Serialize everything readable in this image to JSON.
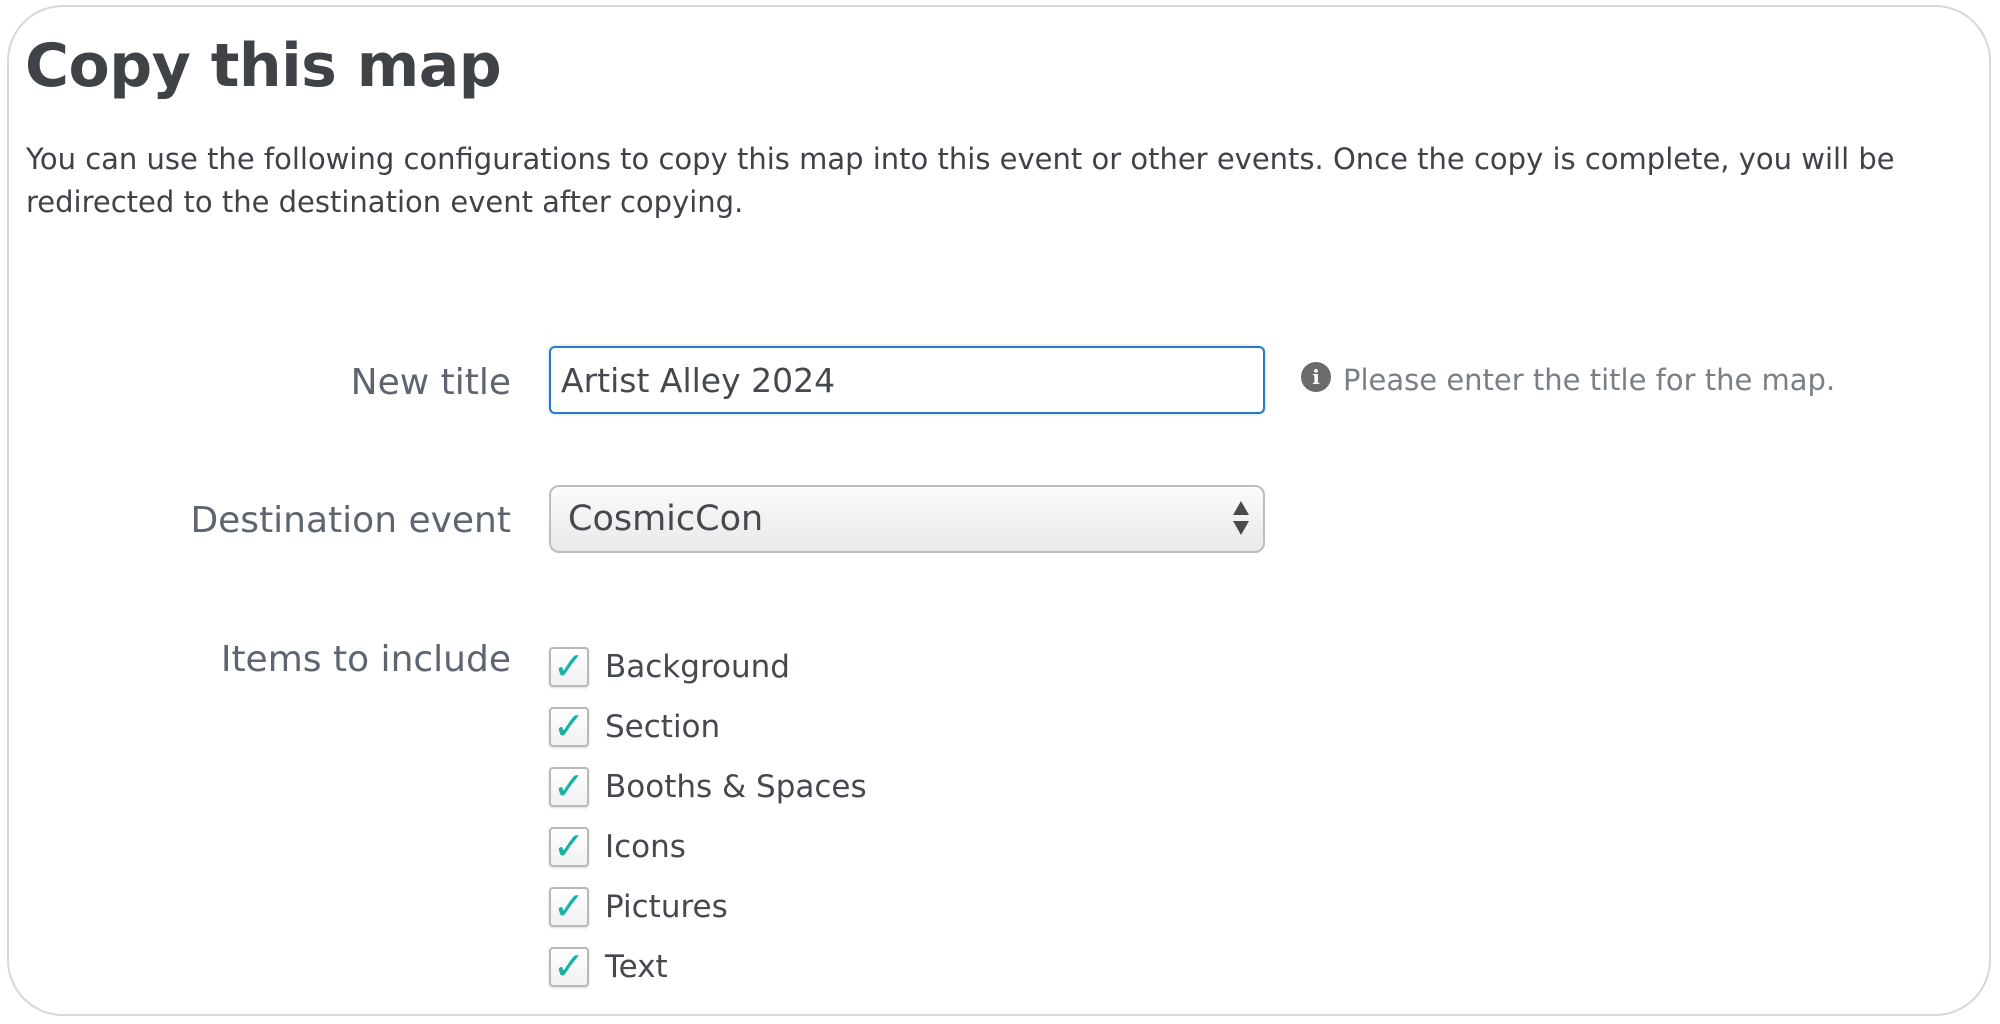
{
  "page": {
    "title": "Copy this map",
    "description": "You can use the following configurations to copy this map into this event or other events. Once the copy is complete, you will be redirected to the destination event after copying."
  },
  "form": {
    "new_title": {
      "label": "New title",
      "value": "Artist Alley 2024",
      "hint": "Please enter the title for the map.",
      "hint_icon": "info-icon"
    },
    "destination_event": {
      "label": "Destination event",
      "selected": "CosmicCon"
    },
    "items_to_include": {
      "label": "Items to include",
      "options": [
        {
          "label": "Background",
          "checked": true
        },
        {
          "label": "Section",
          "checked": true
        },
        {
          "label": "Booths & Spaces",
          "checked": true
        },
        {
          "label": "Icons",
          "checked": true
        },
        {
          "label": "Pictures",
          "checked": true
        },
        {
          "label": "Text",
          "checked": true
        }
      ]
    }
  },
  "colors": {
    "input_focus_border": "#2a78c8",
    "checkmark": "#14b3a6",
    "text": "#3f4247",
    "label": "#5e6470"
  }
}
